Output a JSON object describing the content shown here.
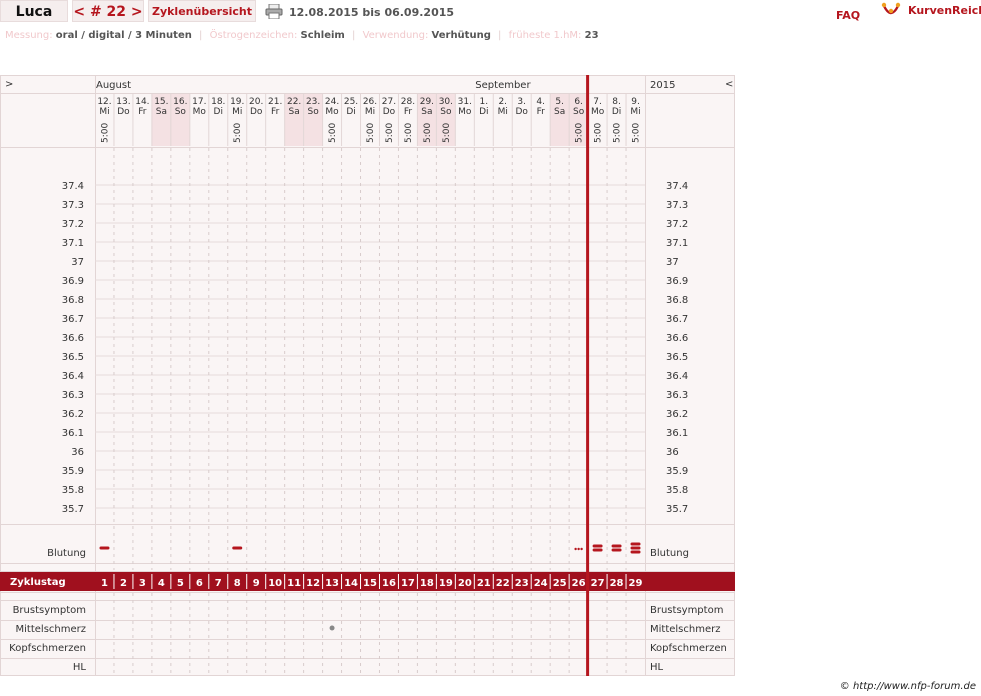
{
  "header": {
    "name": "Luca",
    "cycle_nav": "< # 22 >",
    "overview_label": "Zyklenübersicht",
    "date_range": "12.08.2015 bis 06.09.2015",
    "faq_label": "FAQ",
    "brand": "KurvenReich"
  },
  "info": [
    {
      "label": "Messung:",
      "value": "oral / digital / 3 Minuten"
    },
    {
      "label": "Östrogenzeichen:",
      "value": "Schleim"
    },
    {
      "label": "Verwendung:",
      "value": "Verhütung"
    },
    {
      "label": "früheste 1.hM:",
      "value": "23"
    }
  ],
  "chart_data": {
    "type": "table",
    "left_arrow": ">",
    "right_arrow": "<",
    "year": "2015",
    "months": [
      {
        "label": "August",
        "start_index": 0
      },
      {
        "label": "September",
        "start_index": 20
      }
    ],
    "days": [
      {
        "date": "12.",
        "weekday": "Mi",
        "time": "5:00"
      },
      {
        "date": "13.",
        "weekday": "Do",
        "time": ""
      },
      {
        "date": "14.",
        "weekday": "Fr",
        "time": ""
      },
      {
        "date": "15.",
        "weekday": "Sa",
        "time": "",
        "weekend": true
      },
      {
        "date": "16.",
        "weekday": "So",
        "time": "",
        "weekend": true
      },
      {
        "date": "17.",
        "weekday": "Mo",
        "time": ""
      },
      {
        "date": "18.",
        "weekday": "Di",
        "time": ""
      },
      {
        "date": "19.",
        "weekday": "Mi",
        "time": "5:00"
      },
      {
        "date": "20.",
        "weekday": "Do",
        "time": ""
      },
      {
        "date": "21.",
        "weekday": "Fr",
        "time": ""
      },
      {
        "date": "22.",
        "weekday": "Sa",
        "time": "",
        "weekend": true
      },
      {
        "date": "23.",
        "weekday": "So",
        "time": "",
        "weekend": true
      },
      {
        "date": "24.",
        "weekday": "Mo",
        "time": "5:00"
      },
      {
        "date": "25.",
        "weekday": "Di",
        "time": ""
      },
      {
        "date": "26.",
        "weekday": "Mi",
        "time": "5:00"
      },
      {
        "date": "27.",
        "weekday": "Do",
        "time": "5:00"
      },
      {
        "date": "28.",
        "weekday": "Fr",
        "time": "5:00"
      },
      {
        "date": "29.",
        "weekday": "Sa",
        "time": "5:00",
        "weekend": true
      },
      {
        "date": "30.",
        "weekday": "So",
        "time": "5:00",
        "weekend": true
      },
      {
        "date": "31.",
        "weekday": "Mo",
        "time": ""
      },
      {
        "date": "1.",
        "weekday": "Di",
        "time": ""
      },
      {
        "date": "2.",
        "weekday": "Mi",
        "time": ""
      },
      {
        "date": "3.",
        "weekday": "Do",
        "time": ""
      },
      {
        "date": "4.",
        "weekday": "Fr",
        "time": ""
      },
      {
        "date": "5.",
        "weekday": "Sa",
        "time": "",
        "weekend": true
      },
      {
        "date": "6.",
        "weekday": "So",
        "time": "5:00",
        "weekend": true
      },
      {
        "date": "7.",
        "weekday": "Mo",
        "time": "5:00"
      },
      {
        "date": "8.",
        "weekday": "Di",
        "time": "5:00"
      },
      {
        "date": "9.",
        "weekday": "Mi",
        "time": "5:00"
      }
    ],
    "temperature_ticks": [
      "37.4",
      "37.3",
      "37.2",
      "37.1",
      "37",
      "36.9",
      "36.8",
      "36.7",
      "36.6",
      "36.5",
      "36.4",
      "36.3",
      "36.2",
      "36.1",
      "36",
      "35.9",
      "35.8",
      "35.7"
    ],
    "ylim": [
      35.7,
      37.4
    ],
    "cycle_row_label": "Zyklustag",
    "cycle_days": [
      "1",
      "2",
      "3",
      "4",
      "5",
      "6",
      "7",
      "8",
      "9",
      "10",
      "11",
      "12",
      "13",
      "14",
      "15",
      "16",
      "17",
      "18",
      "19",
      "20",
      "21",
      "22",
      "23",
      "24",
      "25",
      "26",
      "27",
      "28",
      "29"
    ],
    "new_cycle_marker_index": 26,
    "bleeding_label": "Blutung",
    "bleeding": [
      {
        "index": 0,
        "level": "light"
      },
      {
        "index": 7,
        "level": "light"
      },
      {
        "index": 25,
        "level": "spotting"
      },
      {
        "index": 26,
        "level": "medium"
      },
      {
        "index": 27,
        "level": "medium"
      },
      {
        "index": 28,
        "level": "heavy"
      }
    ],
    "symptom_rows": [
      "Brustsymptom",
      "Mittelschmerz",
      "Kopfschmerzen",
      "HL"
    ],
    "symptom_marks": [
      {
        "row": 1,
        "index": 12
      }
    ],
    "colors": {
      "accent": "#b5161e",
      "cycle_bar": "#a0101e",
      "weekend": "#f4e1e3",
      "grid": "#e2d5d5"
    }
  },
  "footer": {
    "copyright": "© http://www.nfp-forum.de"
  }
}
